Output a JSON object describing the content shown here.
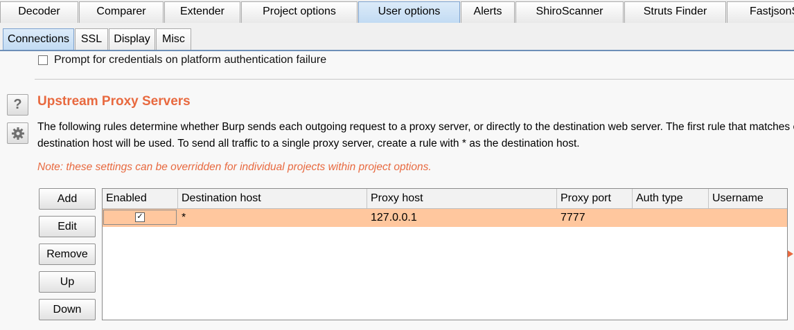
{
  "top_tabs": [
    "Decoder",
    "Comparer",
    "Extender",
    "Project options",
    "User options",
    "Alerts",
    "ShiroScanner",
    "Struts Finder",
    "FastjsonS"
  ],
  "active_top_tab": "User options",
  "sub_tabs": [
    "Connections",
    "SSL",
    "Display",
    "Misc"
  ],
  "active_sub_tab": "Connections",
  "prompt_checkbox": {
    "label": "Prompt for credentials on platform authentication failure",
    "checked": false
  },
  "section": {
    "title": "Upstream Proxy Servers",
    "description_line1": "The following rules determine whether Burp sends each outgoing request to a proxy server, or directly to the destination web server. The first rule that matches e",
    "description_line2": "destination host will be used. To send all traffic to a single proxy server, create a rule with * as the destination host.",
    "note": "Note: these settings can be overridden for individual projects within project options."
  },
  "buttons": {
    "add": "Add",
    "edit": "Edit",
    "remove": "Remove",
    "up": "Up",
    "down": "Down"
  },
  "side_icons": {
    "help": "help-icon",
    "settings": "gear-icon"
  },
  "help_glyph": "?",
  "table": {
    "columns": [
      "Enabled",
      "Destination host",
      "Proxy host",
      "Proxy port",
      "Auth type",
      "Username"
    ],
    "rows": [
      {
        "enabled": true,
        "destination_host": "*",
        "proxy_host": "127.0.0.1",
        "proxy_port": "7777",
        "auth_type": "",
        "username": ""
      }
    ]
  },
  "colors": {
    "accent": "#e8693f",
    "selected_row": "#ffc79e",
    "active_tab": "#c2dbf3"
  }
}
